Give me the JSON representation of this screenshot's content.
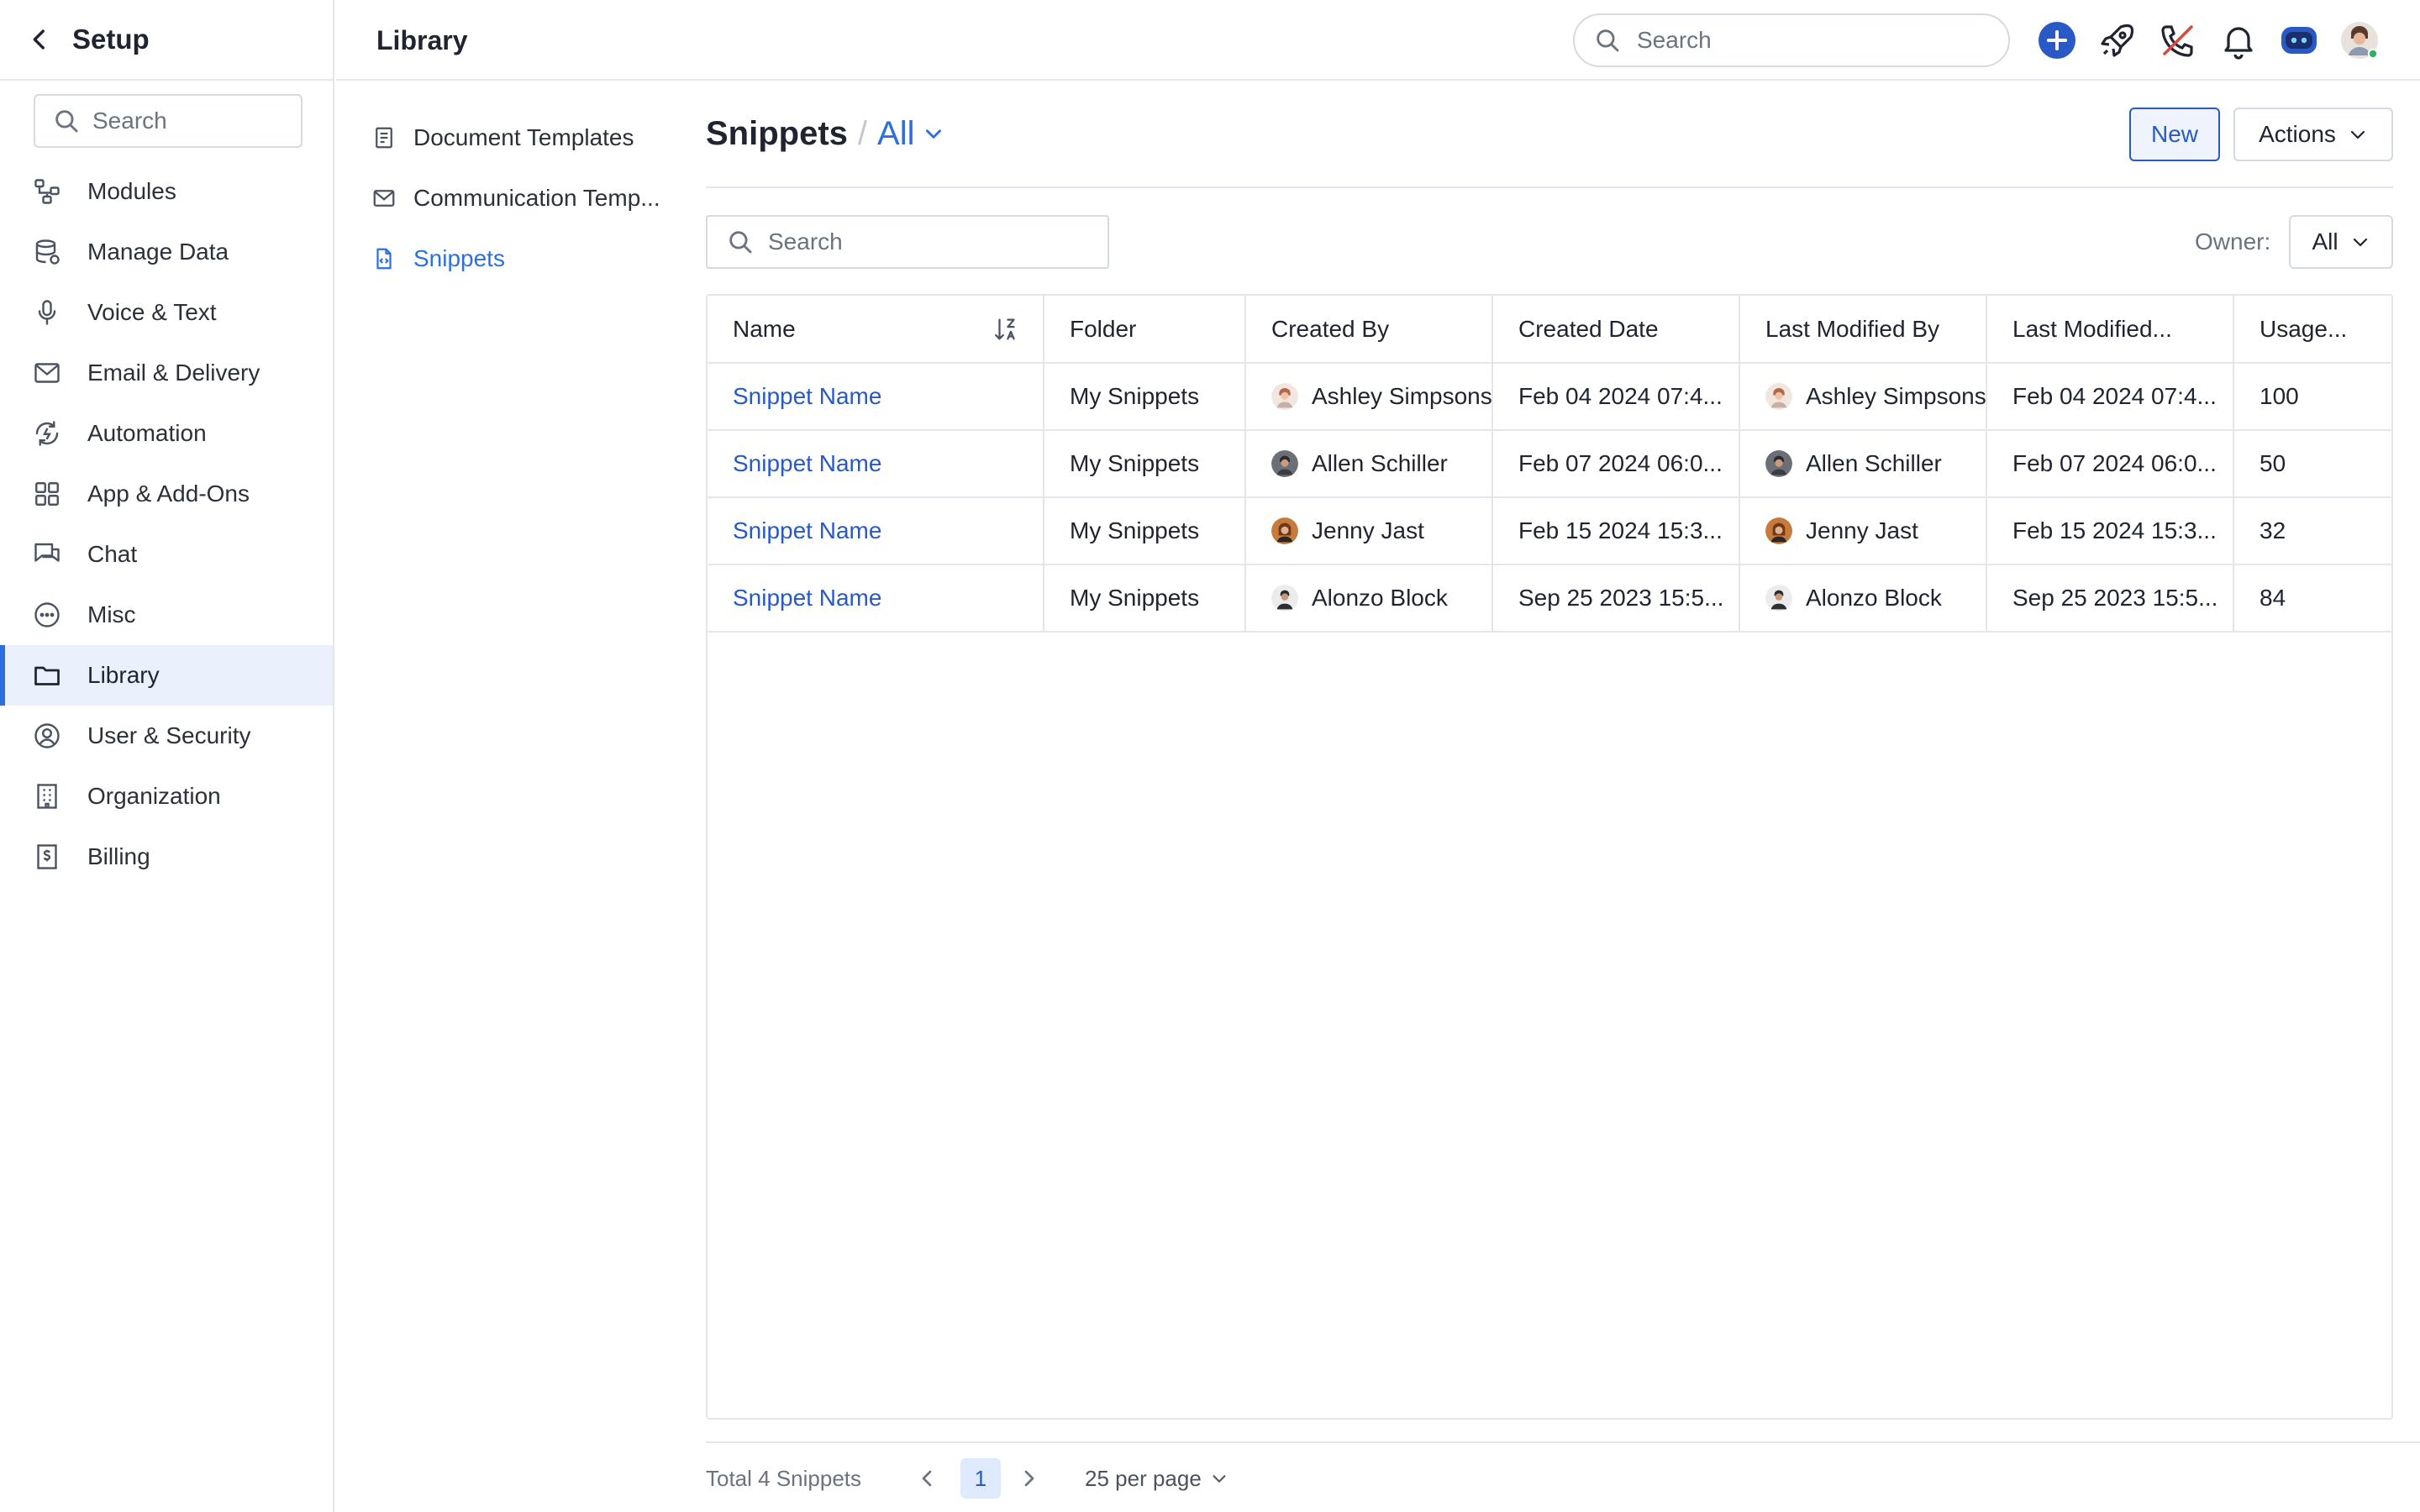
{
  "setup": {
    "title": "Setup",
    "search_placeholder": "Search",
    "nav": [
      {
        "label": "Modules",
        "icon": "modules-icon"
      },
      {
        "label": "Manage Data",
        "icon": "database-icon"
      },
      {
        "label": "Voice & Text",
        "icon": "microphone-icon"
      },
      {
        "label": "Email & Delivery",
        "icon": "mail-icon"
      },
      {
        "label": "Automation",
        "icon": "automation-icon"
      },
      {
        "label": "App & Add-Ons",
        "icon": "apps-grid-icon"
      },
      {
        "label": "Chat",
        "icon": "chat-icon"
      },
      {
        "label": "Misc",
        "icon": "more-circle-icon"
      },
      {
        "label": "Library",
        "icon": "folder-icon",
        "active": true
      },
      {
        "label": "User & Security",
        "icon": "user-circle-icon"
      },
      {
        "label": "Organization",
        "icon": "building-icon"
      },
      {
        "label": "Billing",
        "icon": "billing-icon"
      }
    ]
  },
  "topbar": {
    "title": "Library",
    "search_placeholder": "Search"
  },
  "library_nav": [
    {
      "label": "Document Templates",
      "icon": "document-icon"
    },
    {
      "label": "Communication Temp...",
      "icon": "mail-icon"
    },
    {
      "label": "Snippets",
      "icon": "snippet-file-icon",
      "active": true
    }
  ],
  "main": {
    "title": "Snippets",
    "separator": "/",
    "view": "All",
    "new_label": "New",
    "actions_label": "Actions",
    "search_placeholder": "Search",
    "owner_label": "Owner:",
    "owner_value": "All"
  },
  "table": {
    "columns": [
      "Name",
      "Folder",
      "Created By",
      "Created Date",
      "Last Modified By",
      "Last Modified...",
      "Usage..."
    ],
    "rows": [
      {
        "name": "Snippet Name",
        "folder": "My Snippets",
        "created_by": "Ashley Simpsons",
        "created_date": "Feb 04 2024 07:4...",
        "modified_by": "Ashley Simpsons",
        "modified_date": "Feb 04 2024 07:4...",
        "usage": "100"
      },
      {
        "name": "Snippet Name",
        "folder": "My Snippets",
        "created_by": "Allen Schiller",
        "created_date": "Feb 07 2024 06:0...",
        "modified_by": "Allen Schiller",
        "modified_date": "Feb 07 2024 06:0...",
        "usage": "50"
      },
      {
        "name": "Snippet Name",
        "folder": "My Snippets",
        "created_by": "Jenny Jast",
        "created_date": "Feb 15 2024 15:3...",
        "modified_by": "Jenny Jast",
        "modified_date": "Feb 15 2024 15:3...",
        "usage": "32"
      },
      {
        "name": "Snippet Name",
        "folder": "My Snippets",
        "created_by": "Alonzo Block",
        "created_date": "Sep 25 2023 15:5...",
        "modified_by": "Alonzo Block",
        "modified_date": "Sep 25 2023 15:5...",
        "usage": "84"
      }
    ]
  },
  "footer": {
    "total": "Total 4 Snippets",
    "page": "1",
    "per_page": "25 per page"
  },
  "colors": {
    "accent": "#2e6fe0",
    "link": "#2859c5",
    "active_bg": "#eaf1fd",
    "border": "#e3e6eb"
  }
}
